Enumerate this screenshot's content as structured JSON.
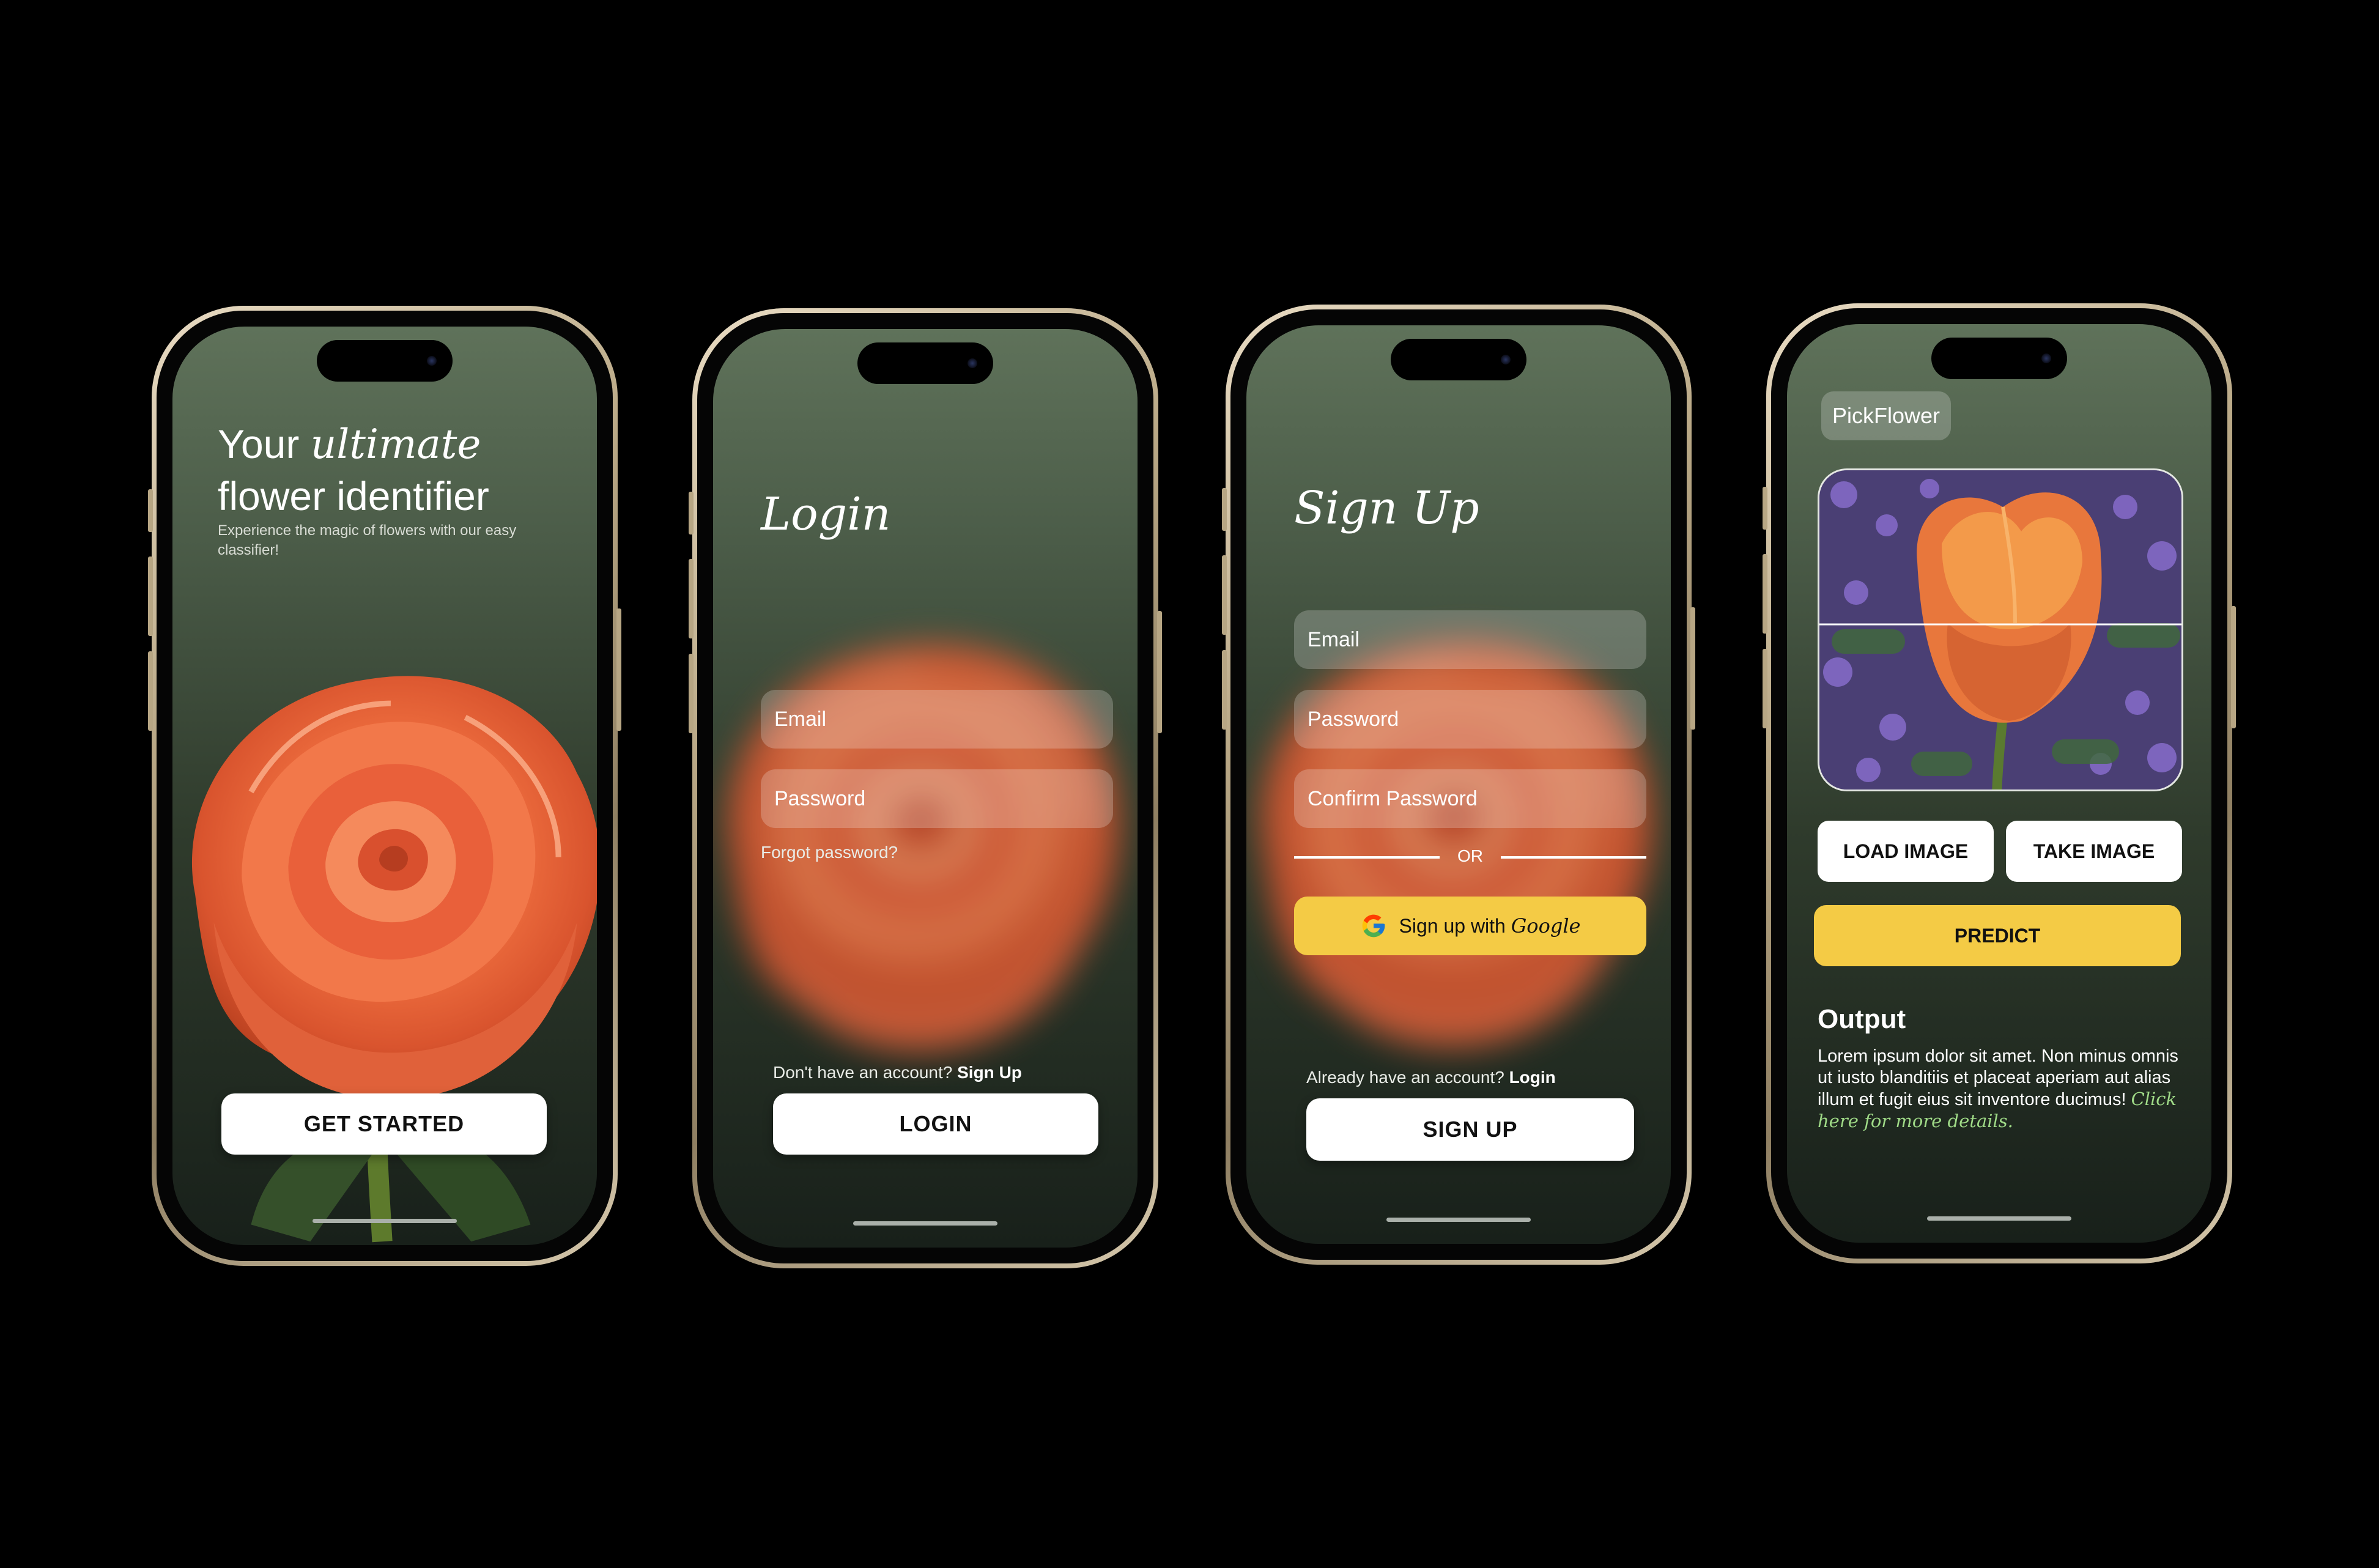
{
  "phones": {
    "welcome": {
      "title_pre": "Your ",
      "title_italic": "ultimate",
      "title_line2": "flower identifier",
      "subtitle": "Experience the magic of flowers with our easy classifier!",
      "cta": "GET STARTED"
    },
    "login": {
      "title": "Login",
      "email_placeholder": "Email",
      "password_placeholder": "Password",
      "forgot": "Forgot password?",
      "no_account": "Don't have an account?",
      "signup_link": "Sign Up",
      "submit": "LOGIN"
    },
    "signup": {
      "title": "Sign Up",
      "email_placeholder": "Email",
      "password_placeholder": "Password",
      "confirm_placeholder": "Confirm Password",
      "or": "OR",
      "google_prefix": "Sign up with",
      "google_word": "Google",
      "have_account": "Already have an account?",
      "login_link": "Login",
      "submit": "SIGN UP"
    },
    "classifier": {
      "app_name": "PickFlower",
      "load": "LOAD IMAGE",
      "take": "TAKE IMAGE",
      "predict": "PREDICT",
      "output_title": "Output",
      "output_text": "Lorem ipsum dolor sit amet. Non minus omnis ut iusto blanditiis et placeat aperiam aut alias illum et fugit eius sit inventore ducimus!",
      "details_link": "Click here for more details."
    }
  },
  "colors": {
    "accent_yellow": "#f4cb45",
    "screen_top": "#5f725a",
    "screen_bottom": "#18201a",
    "link_green": "#9fda87",
    "frame_gold": "#c9b894"
  },
  "icons": [
    "google-icon"
  ]
}
